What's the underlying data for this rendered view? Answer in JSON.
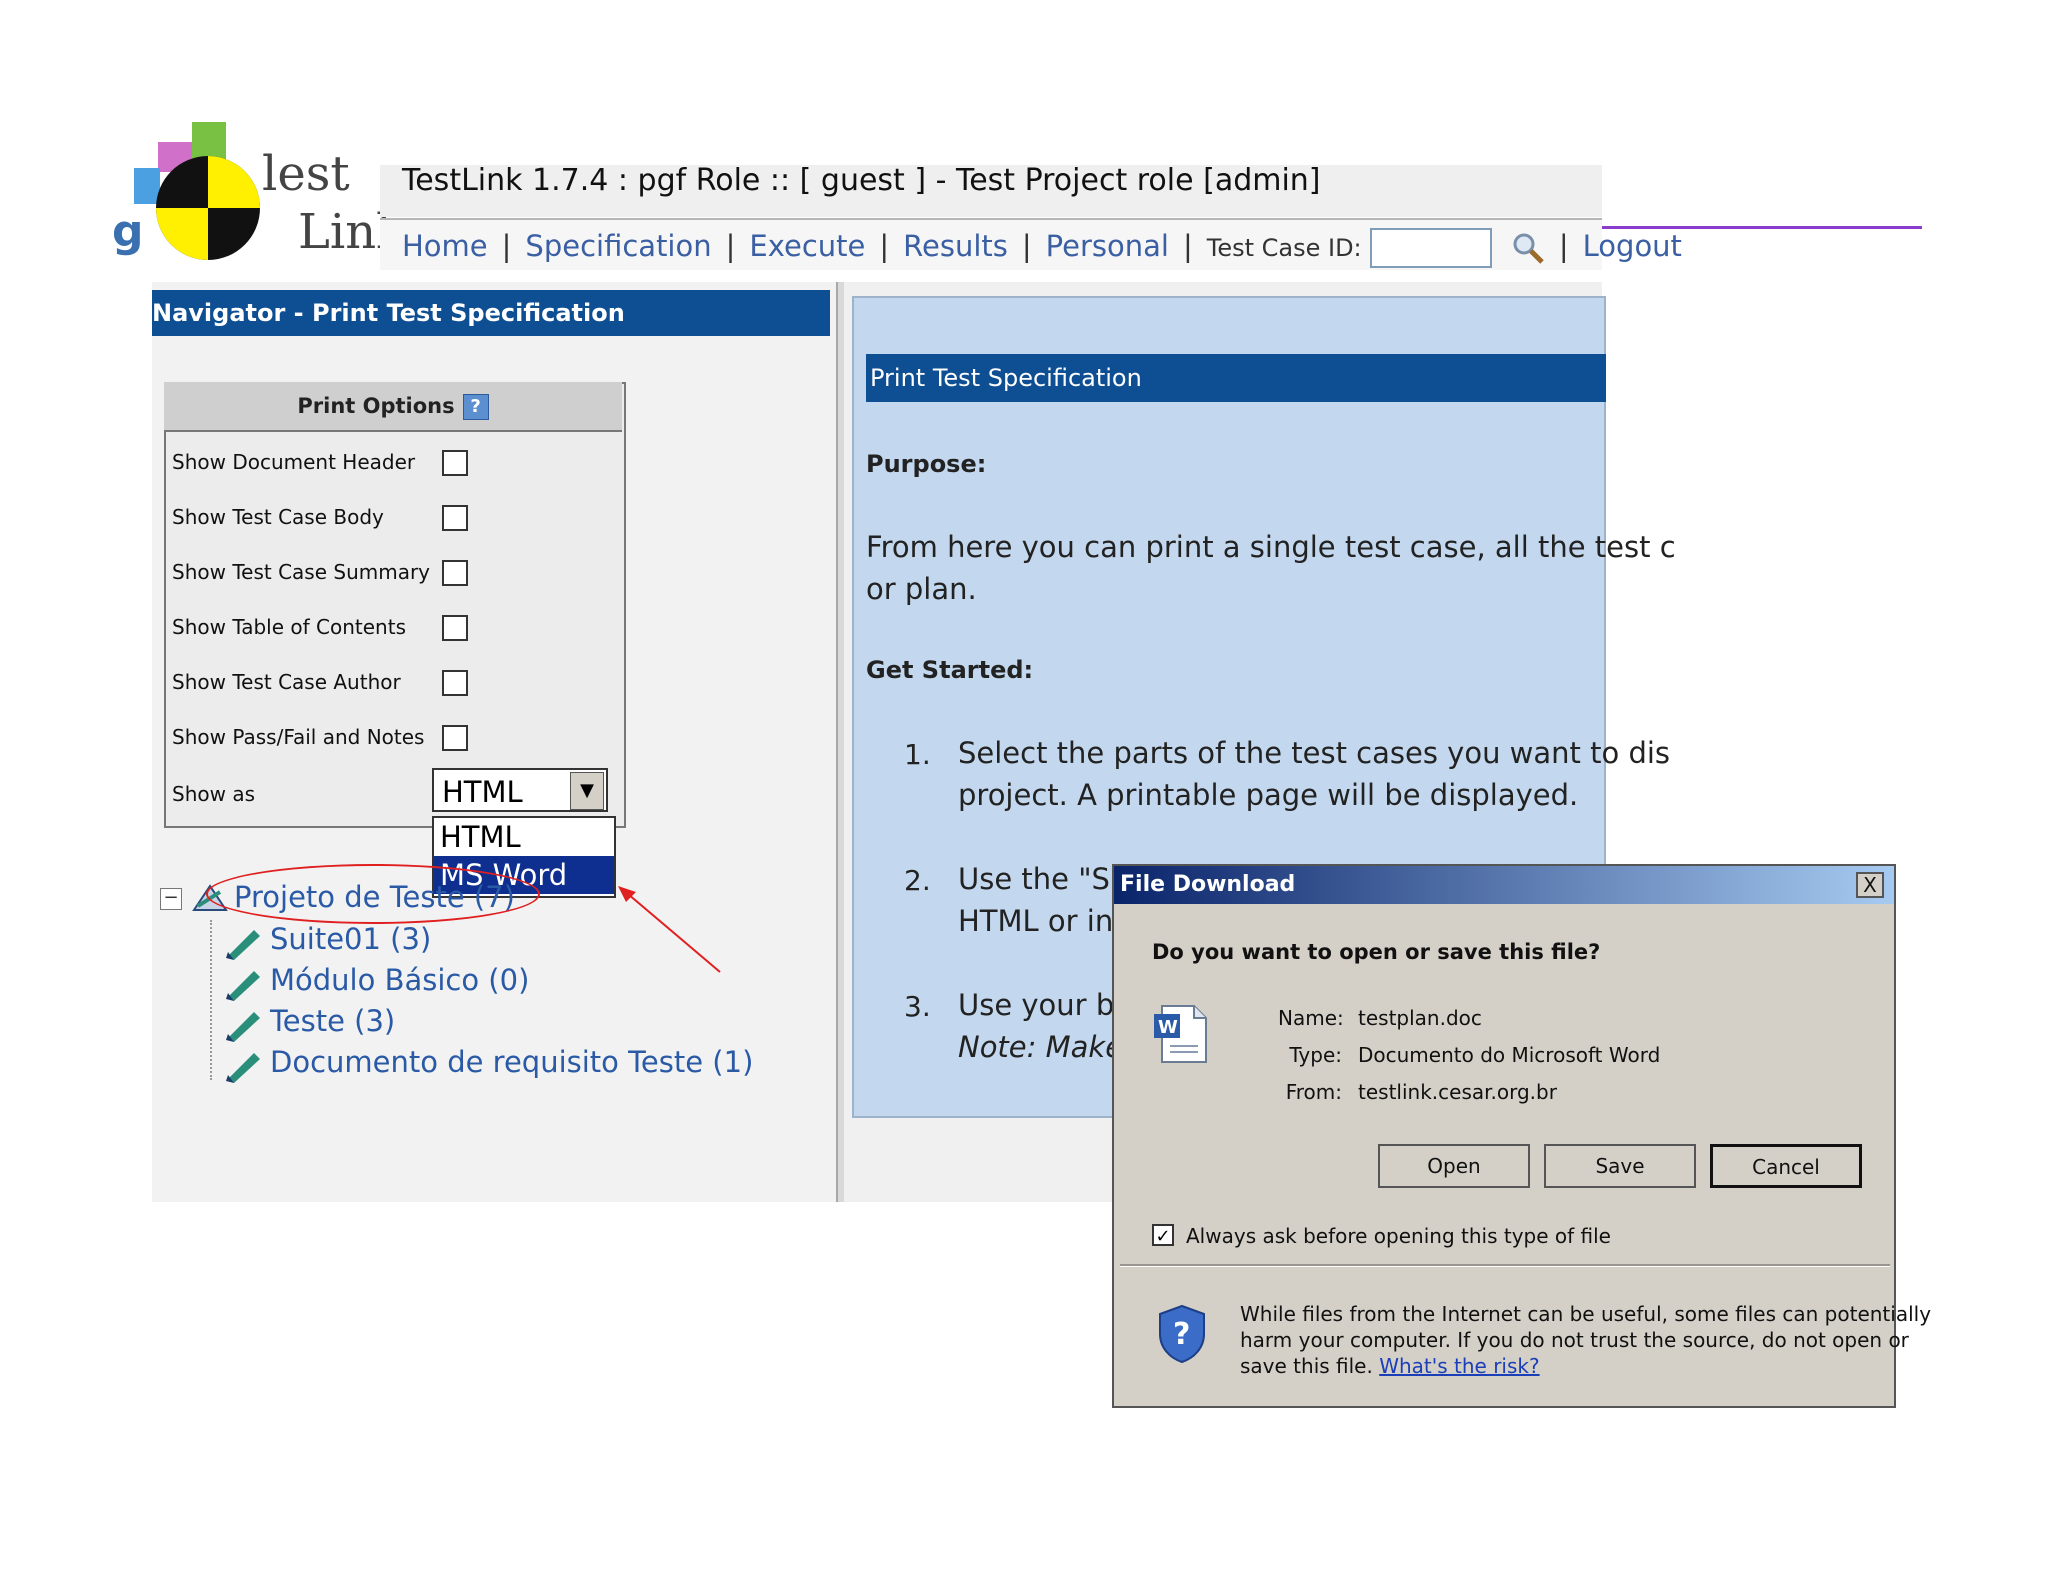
{
  "header": {
    "title": "TestLink 1.7.4 : pgf Role :: [ guest ] - Test Project role [admin]",
    "logo_text_1": "lest",
    "logo_text_2": "Link",
    "nav": [
      "Home",
      "Specification",
      "Execute",
      "Results",
      "Personal"
    ],
    "test_case_id_label": "Test Case ID:",
    "logout": "Logout"
  },
  "left": {
    "header": "Navigator - Print Test Specification",
    "print_options_title": "Print Options",
    "help_glyph": "?",
    "options": [
      {
        "label": "Show Document Header",
        "checked": false
      },
      {
        "label": "Show Test Case Body",
        "checked": false
      },
      {
        "label": "Show Test Case Summary",
        "checked": false
      },
      {
        "label": "Show Table of Contents",
        "checked": false
      },
      {
        "label": "Show Test Case Author",
        "checked": false
      },
      {
        "label": "Show Pass/Fail and Notes",
        "checked": false
      }
    ],
    "show_as_label": "Show as",
    "show_as_value": "HTML",
    "show_as_options": [
      "HTML",
      "MS Word"
    ],
    "tree": {
      "root": "Projeto de Teste (7)",
      "children": [
        "Suite01 (3)",
        "Módulo Básico (0)",
        "Teste (3)",
        "Documento de requisito Teste (1)"
      ]
    }
  },
  "right": {
    "header": "Print Test Specification",
    "purpose_label": "Purpose:",
    "purpose_line1": "From here you can print a single test case, all the test c",
    "purpose_line2": "or plan.",
    "get_started_label": "Get Started:",
    "steps": [
      {
        "num": "1.",
        "line1": "Select the parts of the test cases you want to dis",
        "line2": "project. A printable page will be displayed."
      },
      {
        "num": "2.",
        "line1": "Use the \"Sh",
        "line2": "HTML or in"
      },
      {
        "num": "3.",
        "line1": "Use your bro",
        "line2": "Note: Make"
      }
    ]
  },
  "dialog": {
    "title": "File Download",
    "close_glyph": "X",
    "question": "Do you want to open or save this file?",
    "name_label": "Name:",
    "name_value": "testplan.doc",
    "type_label": "Type:",
    "type_value": "Documento do Microsoft Word",
    "from_label": "From:",
    "from_value": "testlink.cesar.org.br",
    "buttons": [
      "Open",
      "Save",
      "Cancel"
    ],
    "always_ask_label": "Always ask before opening this type of file",
    "always_ask_checked": true,
    "warning_line1": "While files from the Internet can be useful, some files can potentially",
    "warning_line2": "harm your computer. If you do not trust the source, do not open or",
    "warning_line3": "save this file.",
    "risk_link": "What's the risk?"
  },
  "colors": {
    "header_blue": "#0e4e93",
    "content_blue": "#c3d8ee",
    "link_blue": "#3a5fa3",
    "annotation_red": "#e02020",
    "accent_purple": "#8a3ccf"
  }
}
